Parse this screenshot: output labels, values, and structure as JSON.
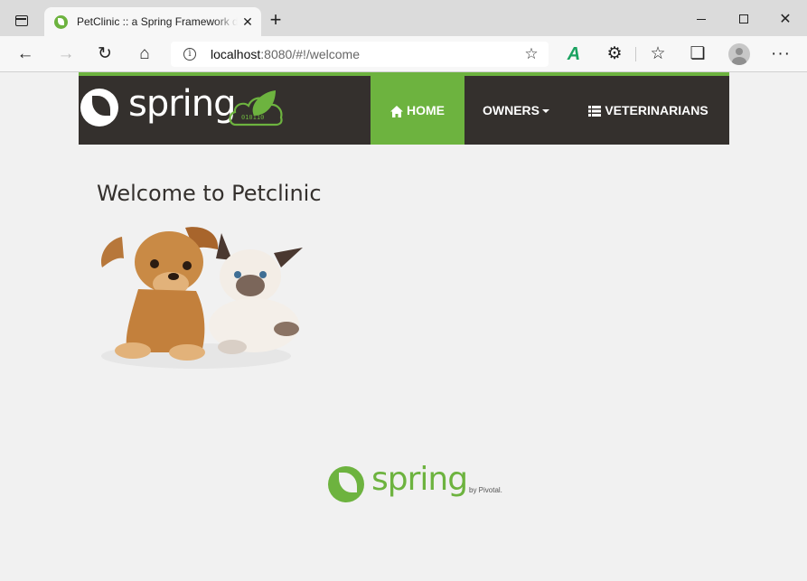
{
  "browser": {
    "tab": {
      "title": "PetClinic :: a Spring Framework demonstration",
      "close_glyph": "✕"
    },
    "new_tab_glyph": "+",
    "window_controls": {
      "close_glyph": "✕"
    },
    "address": {
      "host": "localhost",
      "rest": ":8080/#!/welcome"
    },
    "icons": {
      "back": "←",
      "forward": "→",
      "reload": "↻",
      "home": "⌂",
      "info": "i",
      "favorite_add": "☆",
      "extension_a": "A",
      "extensions": "⚙",
      "favorites": "☆",
      "collections": "❏",
      "menu": "···"
    }
  },
  "page": {
    "brand": {
      "text": "spring",
      "cloud_digits": "010110"
    },
    "nav": {
      "home": "Home",
      "owners": "Owners",
      "veterinarians": "Veterinarians"
    },
    "title": "Welcome to Petclinic",
    "footer": {
      "text": "spring",
      "by": "by Pivotal."
    }
  },
  "colors": {
    "spring_green": "#6db33f",
    "navbar_bg": "#34302d",
    "page_bg": "#f1f1f1"
  }
}
